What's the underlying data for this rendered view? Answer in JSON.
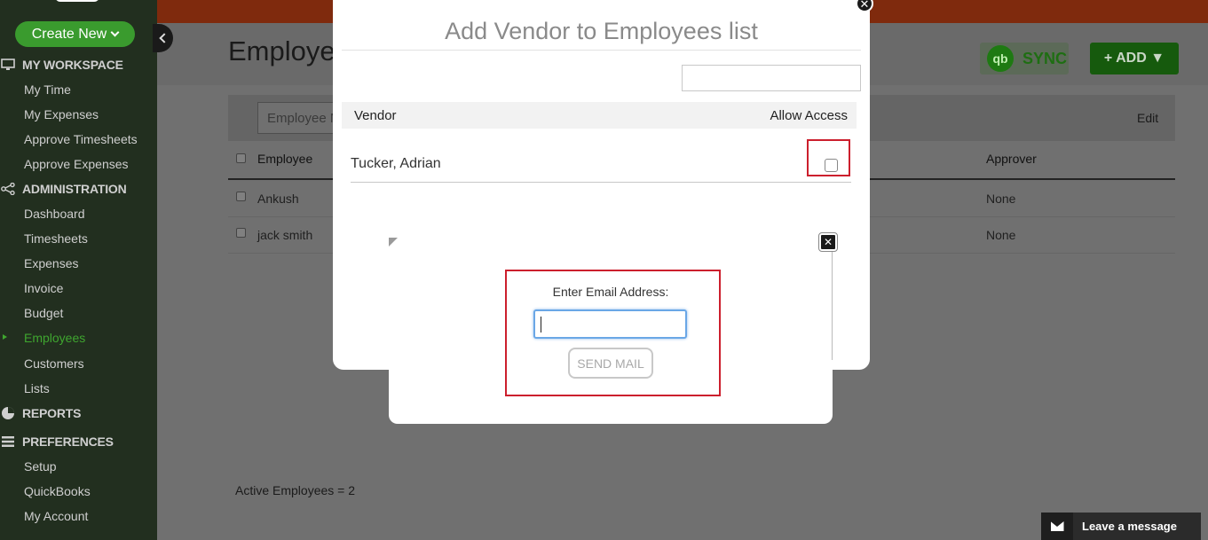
{
  "sidebar": {
    "create_new": "Create New",
    "sections": {
      "workspace": "MY WORKSPACE",
      "administration": "ADMINISTRATION",
      "reports": "REPORTS",
      "preferences": "PREFERENCES"
    },
    "workspace_items": [
      "My Time",
      "My Expenses",
      "Approve Timesheets",
      "Approve Expenses"
    ],
    "admin_items": [
      "Dashboard",
      "Timesheets",
      "Expenses",
      "Invoice",
      "Budget",
      "Employees",
      "Customers",
      "Lists"
    ],
    "preference_items": [
      "Setup",
      "QuickBooks",
      "My Account"
    ],
    "active_item": "Employees"
  },
  "main": {
    "page_title": "Employee",
    "sync_label": "SYNC",
    "qb_logo": "qb",
    "add_label": "+ ADD ▼",
    "filter_placeholder": "Employee N",
    "edit_link": "Edit",
    "columns": {
      "employee": "Employee",
      "approver": "Approver"
    },
    "rows": [
      {
        "employee": "Ankush",
        "approver": "None"
      },
      {
        "employee": "jack smith",
        "approver": "None"
      }
    ],
    "active_count": "Active Employees = 2"
  },
  "vendor_modal": {
    "title": "Add Vendor to Employees list",
    "col_vendor": "Vendor",
    "col_access": "Allow Access",
    "vendor_name": "Tucker, Adrian",
    "close_glyph": "✕"
  },
  "email_popup": {
    "label": "Enter Email Address:",
    "value": "",
    "send_label": "SEND MAIL",
    "close_glyph": "✕"
  },
  "chat": {
    "label": "Leave a message"
  },
  "colors": {
    "accent_green": "#3a9b2e",
    "highlight_red": "#cc1f2d",
    "topbar": "#7f2a0d"
  }
}
